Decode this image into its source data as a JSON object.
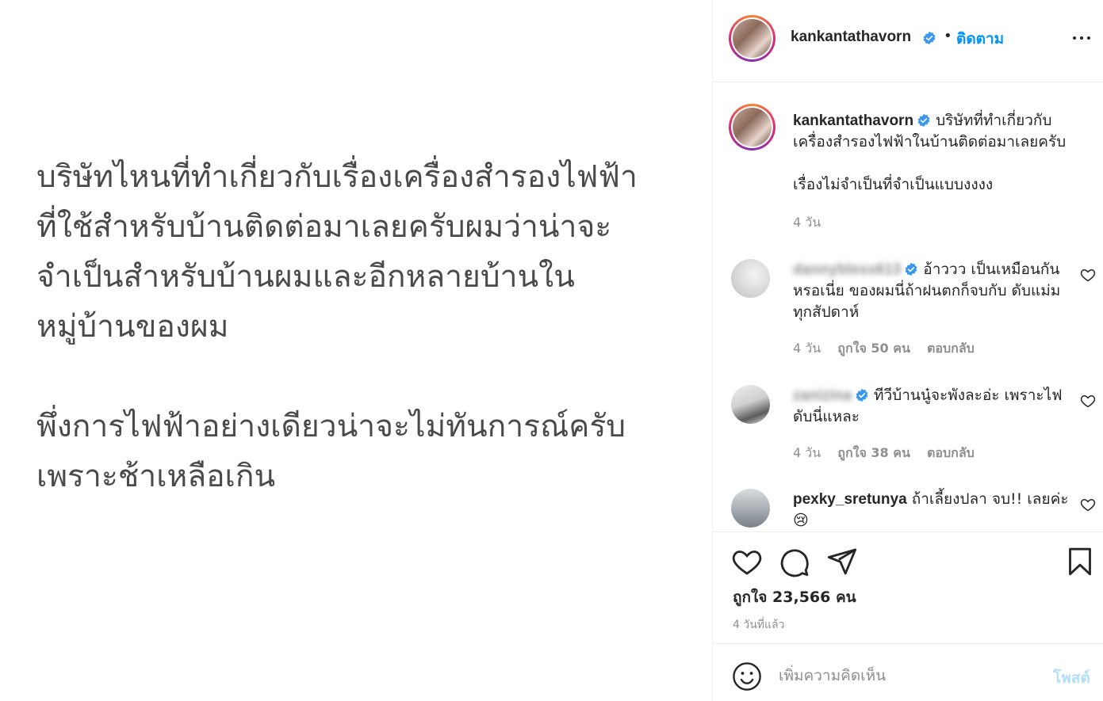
{
  "post_image": {
    "paragraph1": "บริษัทไหนที่ทำเกี่ยวกับเรื่องเครื่องสำรองไฟฟ้า\nที่ใช้สำหรับบ้านติดต่อมาเลยครับผมว่าน่าจะ\nจำเป็นสำหรับบ้านผมและอีกหลายบ้านใน\nหมู่บ้านของผม",
    "paragraph2": "พึ่งการไฟฟ้าอย่างเดียวน่าจะไม่ทันการณ์ครับ\nเพราะช้าเหลือเกิน"
  },
  "header": {
    "username": "kankantathavorn",
    "separator": "•",
    "follow_label": "ติดตาม"
  },
  "caption": {
    "username": "kankantathavorn",
    "text_line1": "บริษัทที่ทำเกี่ยวกับเครื่องสำรองไฟฟ้าในบ้านติดต่อมาเลยครับ",
    "text_line2": "เรื่องไม่จำเป็นที่จำเป็นแบบงงงง",
    "time": "4 วัน"
  },
  "comments": [
    {
      "username": "dannybless613",
      "text": "อ้าววว เป็นเหมือนกันหรอเนี่ย ของผมนี่ถ้าฝนตกก็จบกับ ดับแม่มทุกสัปดาห์",
      "time": "4 วัน",
      "likes": "ถูกใจ 50 คน",
      "reply": "ตอบกลับ"
    },
    {
      "username": "zanizina",
      "text": "ทีวีบ้านนู๋จะพังละอ่ะ เพราะไฟดับนี่แหละ",
      "time": "4 วัน",
      "likes": "ถูกใจ 38 คน",
      "reply": "ตอบกลับ"
    },
    {
      "username": "pexky_sretunya",
      "text": "ถ้าเลี้ยงปลา จบ!! เลยค่ะ 😢"
    }
  ],
  "actions": {
    "likes_label": "ถูกใจ 23,566 คน",
    "post_time": "4 วันที่แล้ว"
  },
  "add_comment": {
    "placeholder": "เพิ่มความคิดเห็น",
    "post_label": "โพสต์"
  },
  "colors": {
    "link_blue": "#0095f6",
    "post_disabled": "#b2dffc",
    "muted": "#8e8e8e",
    "verified": "#3897f0"
  }
}
